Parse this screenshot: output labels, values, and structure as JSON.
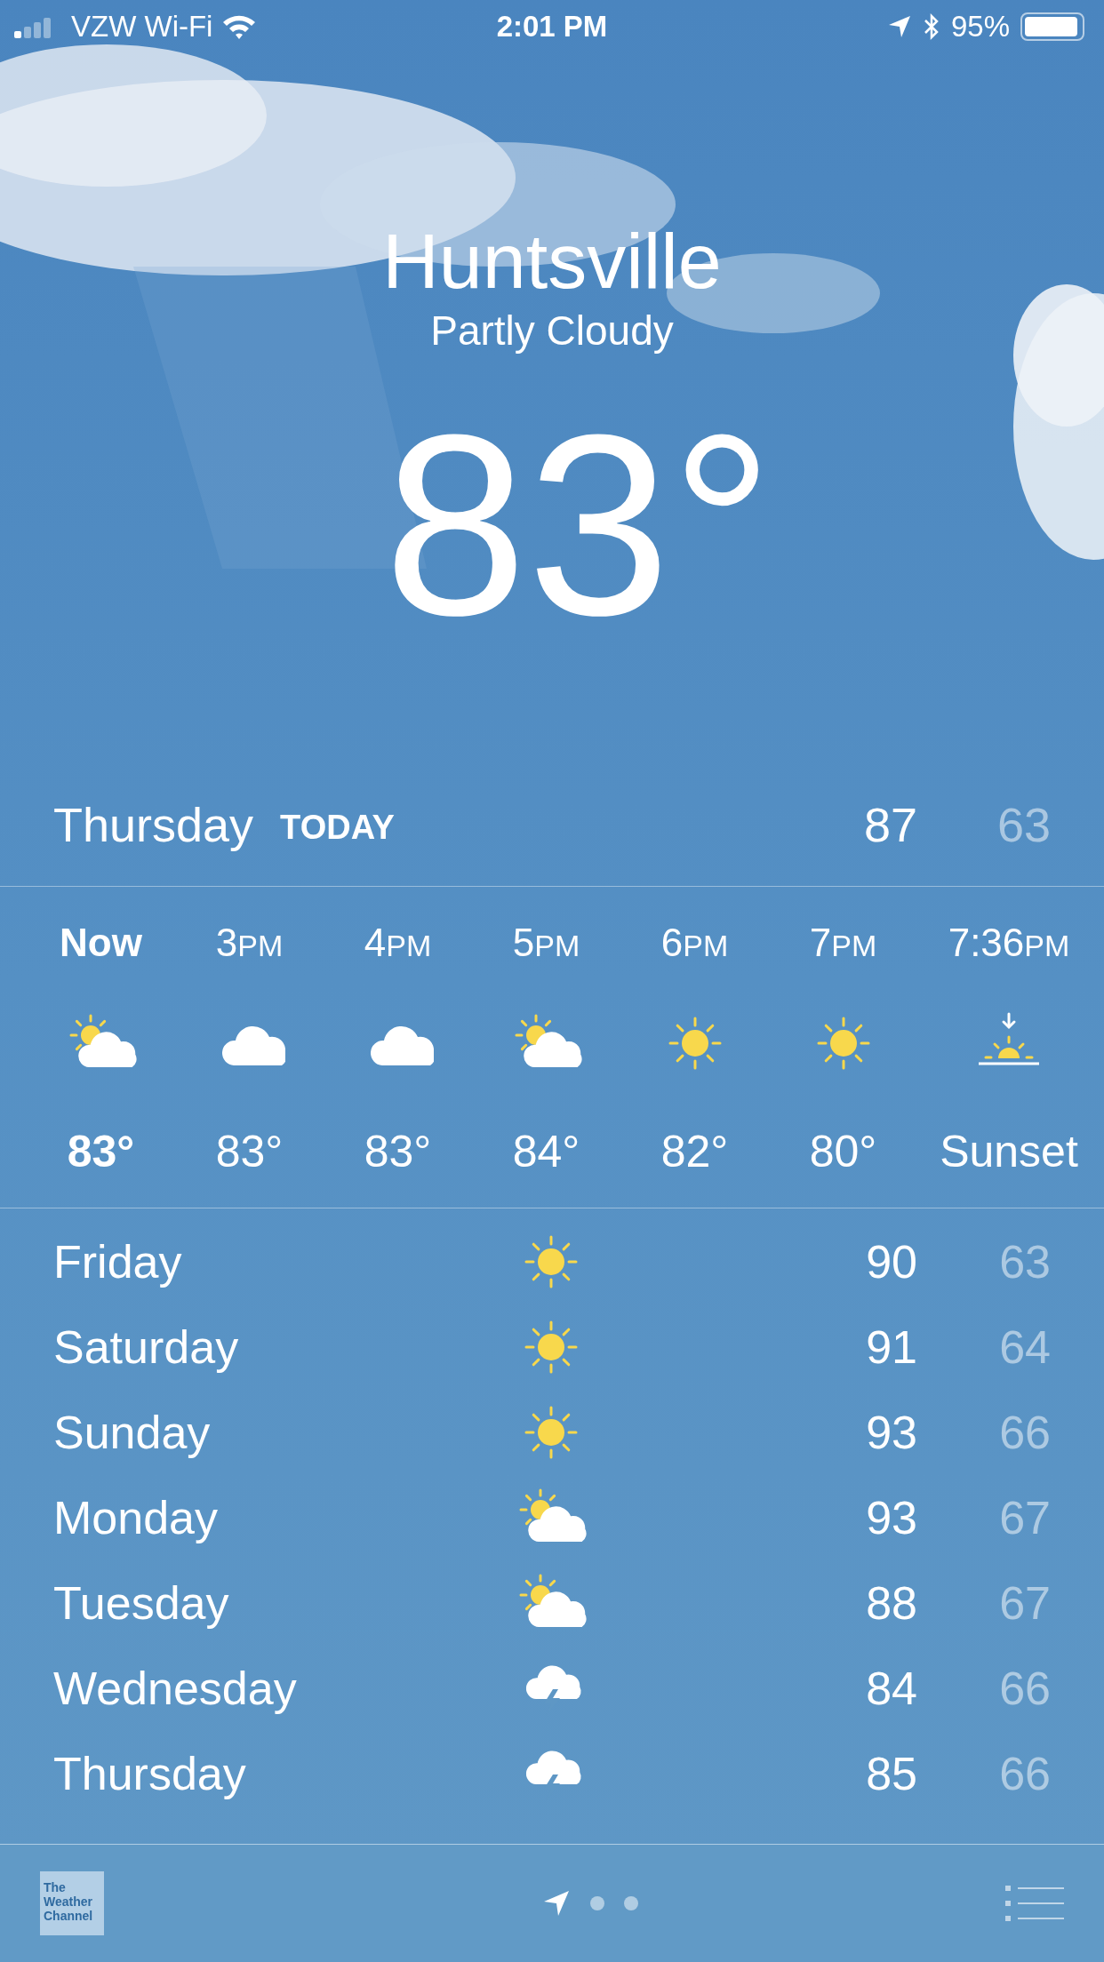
{
  "status_bar": {
    "carrier": "VZW Wi-Fi",
    "time": "2:01 PM",
    "battery": "95%"
  },
  "header": {
    "city": "Huntsville",
    "condition": "Partly Cloudy",
    "temperature": "83°"
  },
  "today": {
    "day": "Thursday",
    "tag": "TODAY",
    "high": "87",
    "low": "63"
  },
  "hourly": [
    {
      "time": "Now",
      "current": true,
      "kind": "partly-cloudy",
      "temp": "83°"
    },
    {
      "time": "3",
      "suffix": "PM",
      "current": false,
      "kind": "cloudy",
      "temp": "83°"
    },
    {
      "time": "4",
      "suffix": "PM",
      "current": false,
      "kind": "cloudy",
      "temp": "83°"
    },
    {
      "time": "5",
      "suffix": "PM",
      "current": false,
      "kind": "partly-cloudy",
      "temp": "84°"
    },
    {
      "time": "6",
      "suffix": "PM",
      "current": false,
      "kind": "sunny",
      "temp": "82°"
    },
    {
      "time": "7",
      "suffix": "PM",
      "current": false,
      "kind": "sunny",
      "temp": "80°"
    },
    {
      "time": "7:36",
      "suffix": "PM",
      "current": false,
      "kind": "sunset",
      "temp": "Sunset"
    }
  ],
  "daily": [
    {
      "day": "Friday",
      "kind": "sunny",
      "high": "90",
      "low": "63"
    },
    {
      "day": "Saturday",
      "kind": "sunny",
      "high": "91",
      "low": "64"
    },
    {
      "day": "Sunday",
      "kind": "sunny",
      "high": "93",
      "low": "66"
    },
    {
      "day": "Monday",
      "kind": "partly-cloudy",
      "high": "93",
      "low": "67"
    },
    {
      "day": "Tuesday",
      "kind": "partly-cloudy",
      "high": "88",
      "low": "67"
    },
    {
      "day": "Wednesday",
      "kind": "thunderstorm",
      "high": "84",
      "low": "66"
    },
    {
      "day": "Thursday",
      "kind": "thunderstorm",
      "high": "85",
      "low": "66"
    }
  ],
  "bottom_bar": {
    "logo": "The Weather Channel",
    "pages": [
      {
        "kind": "location",
        "selected": true
      },
      {
        "kind": "dot",
        "selected": false
      },
      {
        "kind": "dot",
        "selected": false
      }
    ]
  }
}
